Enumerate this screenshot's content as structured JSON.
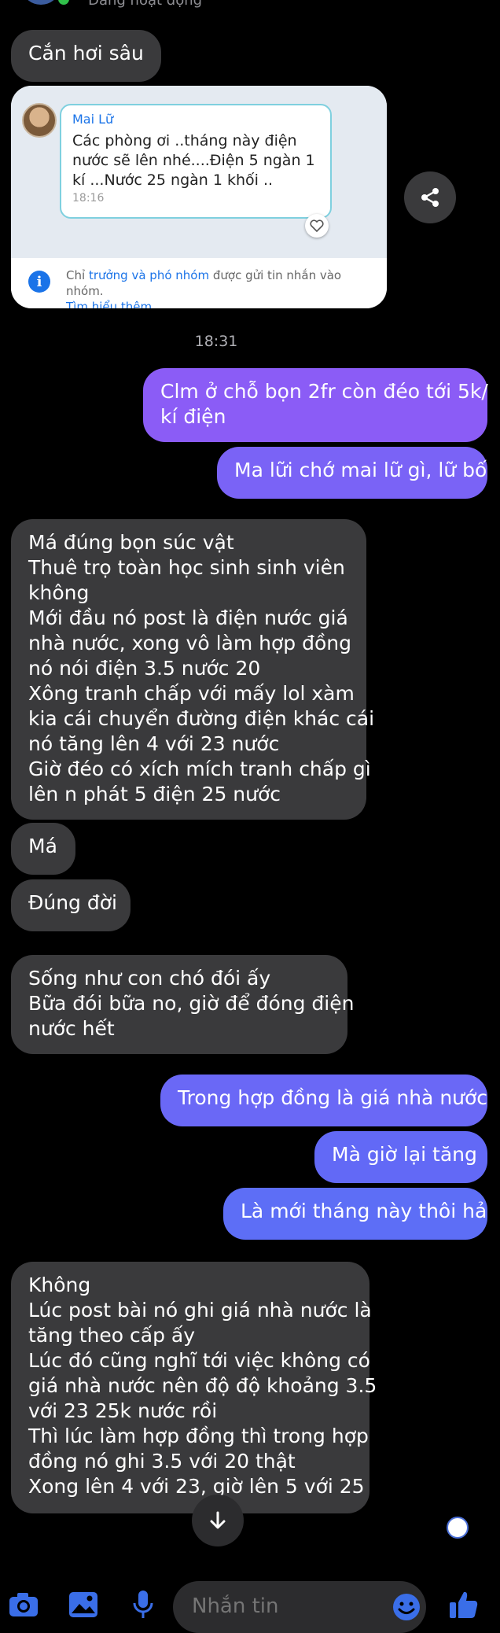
{
  "header": {
    "status_text": "Đang hoạt động"
  },
  "card": {
    "quote_sender": "Mai Lữ",
    "quote_lines": [
      "Các phòng ơi ..tháng này điện",
      "nước sẽ lên nhé....Điện 5 ngàn 1",
      "kí ...Nước 25 ngàn 1 khối .."
    ],
    "quote_time": "18:16",
    "notice_prefix": "Chỉ",
    "notice_link": "trưởng và phó nhóm",
    "notice_suffix": "được gửi tin nhắn vào nhóm.",
    "learn_more": "Tìm hiểu thêm"
  },
  "messages": {
    "m0": [
      "Cắn hơi sâu"
    ],
    "timestamp": "18:31",
    "m1": [
      "Clm ở chỗ bọn 2fr còn đéo tới 5k/",
      "kí điện"
    ],
    "m2": [
      "Ma lữi chớ mai lữ gì, lữ bố"
    ],
    "m3": [
      "Má đúng bọn súc vật",
      "Thuê trọ toàn học sinh sinh viên",
      "không",
      "Mới đầu nó post là điện nước giá",
      "nhà nước, xong vô làm hợp đồng",
      "nó nói điện 3.5 nước 20",
      "Xông tranh chấp với mấy lol xàm",
      "kia cái chuyển đường điện khác cái",
      "nó tăng lên 4 với 23 nước",
      "Giờ đéo có xích mích tranh chấp gì",
      "lên n phát 5 điện 25 nước"
    ],
    "m4": [
      "Má"
    ],
    "m5": [
      "Đúng đời"
    ],
    "m6": [
      "Sống như con chó đói ấy",
      "Bữa đói bữa no, giờ để đóng điện",
      "nước hết"
    ],
    "m7": [
      "Trong hợp đồng là giá nhà nước"
    ],
    "m8": [
      "Mà giờ lại tăng"
    ],
    "m9": [
      "Là mới tháng này thôi hả"
    ],
    "m10": [
      "Không",
      "Lúc post bài nó ghi giá nhà nước là",
      "tăng theo cấp ấy",
      "Lúc đó cũng nghĩ tới việc không có",
      "giá nhà nước nên độ độ khoảng 3.5",
      "với 23 25k nước rồi",
      "Thì lúc làm hợp đồng thì trong hợp",
      "đồng nó ghi 3.5 với 20 thật",
      "Xong lên 4 với 23, giờ lên 5 với 25"
    ]
  },
  "composer": {
    "placeholder": "Nhắn tin"
  },
  "icons": {
    "camera": "camera-icon",
    "gallery": "image-icon",
    "mic": "microphone-icon",
    "emoji": "emoji-icon",
    "like": "thumbs-up-icon",
    "share": "share-icon",
    "scroll": "arrow-down-icon",
    "heart": "heart-icon",
    "info": "info-icon"
  },
  "colors": {
    "background": "#000000",
    "incoming_bubble": "#3a3a3c",
    "outgoing_top": "#8b5cf6",
    "outgoing_bottom": "#5d6ef6",
    "accent_blue": "#3a6ee8"
  }
}
